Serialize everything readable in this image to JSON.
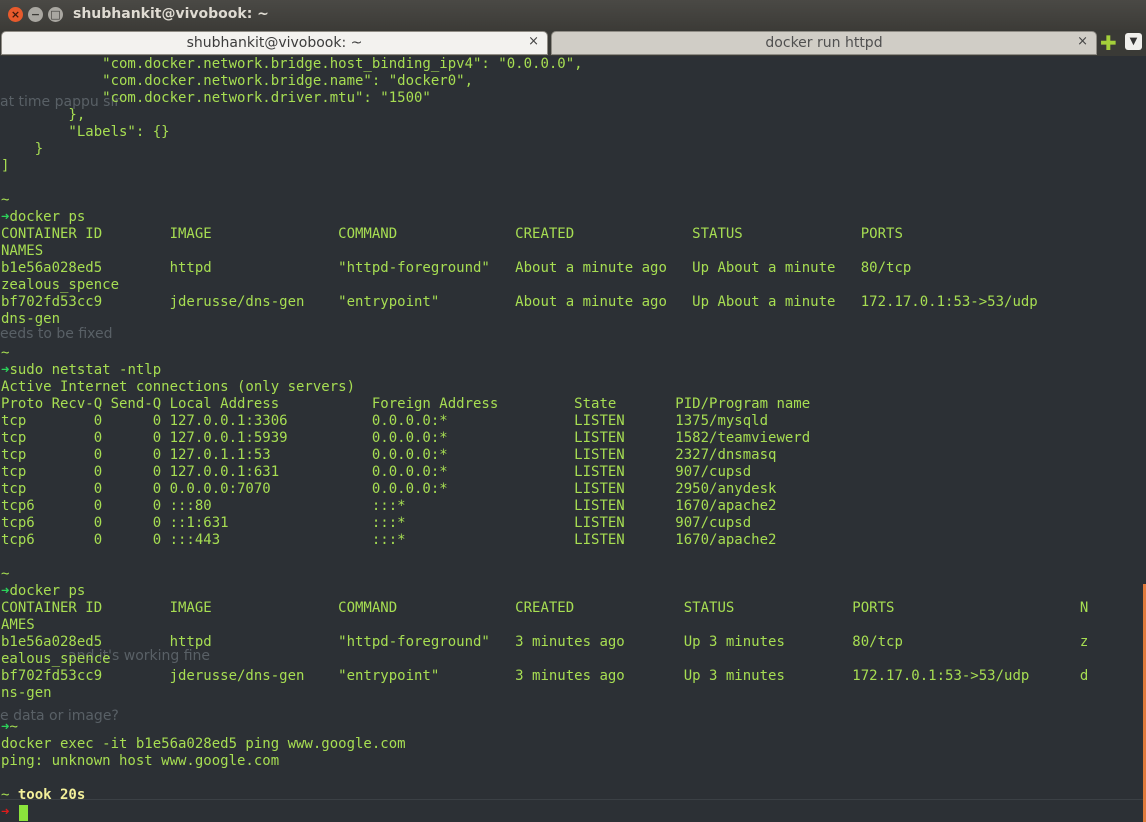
{
  "window": {
    "title": "shubhankit@vivobook: ~",
    "close_glyph": "×",
    "minimize_glyph": "−",
    "maximize_glyph": "□"
  },
  "tabs": [
    {
      "label": "shubhankit@vivobook: ~",
      "close": "×"
    },
    {
      "label": "docker run httpd",
      "close": "×"
    }
  ],
  "new_tab_glyph": "✚",
  "tab_menu_glyph": "▼",
  "terminal": {
    "prompt_arrow": "➜",
    "prompt_tilde": "~",
    "lines": [
      "            \"com.docker.network.bridge.host_binding_ipv4\": \"0.0.0.0\",",
      "            \"com.docker.network.bridge.name\": \"docker0\",",
      "            \"com.docker.network.driver.mtu\": \"1500\"",
      "        },",
      "        \"Labels\": {}",
      "    }",
      "]",
      "",
      "~",
      "docker ps",
      "CONTAINER ID        IMAGE               COMMAND              CREATED              STATUS              PORTS",
      "NAMES",
      "b1e56a028ed5        httpd               \"httpd-foreground\"   About a minute ago   Up About a minute   80/tcp",
      "zealous_spence",
      "bf702fd53cc9        jderusse/dns-gen    \"entrypoint\"         About a minute ago   Up About a minute   172.17.0.1:53->53/udp",
      "dns-gen",
      "",
      "~",
      "sudo netstat -ntlp",
      "Active Internet connections (only servers)",
      "Proto Recv-Q Send-Q Local Address           Foreign Address         State       PID/Program name",
      "tcp        0      0 127.0.0.1:3306          0.0.0.0:*               LISTEN      1375/mysqld",
      "tcp        0      0 127.0.0.1:5939          0.0.0.0:*               LISTEN      1582/teamviewerd",
      "tcp        0      0 127.0.1.1:53            0.0.0.0:*               LISTEN      2327/dnsmasq",
      "tcp        0      0 127.0.0.1:631           0.0.0.0:*               LISTEN      907/cupsd",
      "tcp        0      0 0.0.0.0:7070            0.0.0.0:*               LISTEN      2950/anydesk",
      "tcp6       0      0 :::80                   :::*                    LISTEN      1670/apache2",
      "tcp6       0      0 ::1:631                 :::*                    LISTEN      907/cupsd",
      "tcp6       0      0 :::443                  :::*                    LISTEN      1670/apache2",
      "",
      "~",
      "docker ps",
      "CONTAINER ID        IMAGE               COMMAND              CREATED             STATUS              PORTS                      N",
      "AMES",
      "b1e56a028ed5        httpd               \"httpd-foreground\"   3 minutes ago       Up 3 minutes        80/tcp                     z",
      "ealous_spence",
      "bf702fd53cc9        jderusse/dns-gen    \"entrypoint\"         3 minutes ago       Up 3 minutes        172.17.0.1:53->53/udp      d",
      "ns-gen",
      "",
      "~",
      "docker exec -it b1e56a028ed5 ping www.google.com",
      "ping: unknown host www.google.com",
      "",
      "~",
      ""
    ],
    "took_label": "took 20s"
  },
  "background_ghost_text": [
    "at time pappu sir",
    "eeds to be fixed",
    "and it's working fine",
    "e data or image?"
  ],
  "colors": {
    "terminal_bg": "#2c3035",
    "text_green": "#a7de52",
    "prompt_arrow": "#2bd45b",
    "took_yellow": "#f3f09a",
    "error_arrow": "#e01b1b",
    "tab_active_bg": "#f3f2ef",
    "tab_inactive_bg": "#d0cdc6"
  }
}
